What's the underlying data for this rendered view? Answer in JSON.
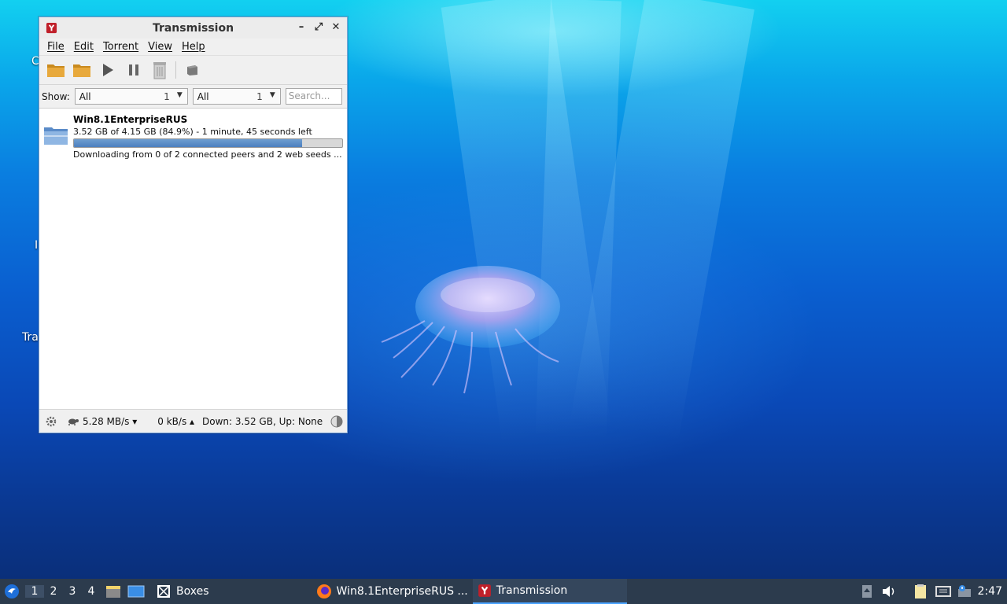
{
  "desktop": {
    "labels": [
      "C",
      "I",
      "Tra"
    ]
  },
  "window": {
    "title": "Transmission",
    "buttons": {
      "minimize": "–",
      "maximize": "⤢",
      "close": "✕"
    },
    "menu": [
      "File",
      "Edit",
      "Torrent",
      "View",
      "Help"
    ],
    "toolbar": [
      "open-folder",
      "open-folder-alt",
      "start",
      "pause",
      "remove",
      "properties"
    ],
    "filter": {
      "show_label": "Show:",
      "activity": {
        "value": "All",
        "count": "1"
      },
      "tracker": {
        "value": "All",
        "count": "1"
      },
      "search_placeholder": "Search..."
    },
    "torrent": {
      "name": "Win8.1EnterpriseRUS",
      "progress_text": "3.52 GB of 4.15 GB (84.9%) - 1 minute, 45 seconds left",
      "progress_fraction": 0.849,
      "status": "Downloading from 0 of 2 connected peers and 2 web seeds ..."
    },
    "statusbar": {
      "down_speed": "5.28 MB/s ▾",
      "up_speed": "0 kB/s ▴",
      "totals": "Down: 3.52 GB, Up: None"
    }
  },
  "taskbar": {
    "workspaces": [
      "1",
      "2",
      "3",
      "4"
    ],
    "tasks": [
      {
        "label": "Boxes"
      },
      {
        "label": "Win8.1EnterpriseRUS ..."
      },
      {
        "label": "Transmission"
      }
    ],
    "clock": "2:47"
  },
  "colors": {
    "taskbar_bg": "#2c3b4d",
    "progress_fill": "#5a8bc8",
    "active_task_underline": "#4aa3ff"
  }
}
